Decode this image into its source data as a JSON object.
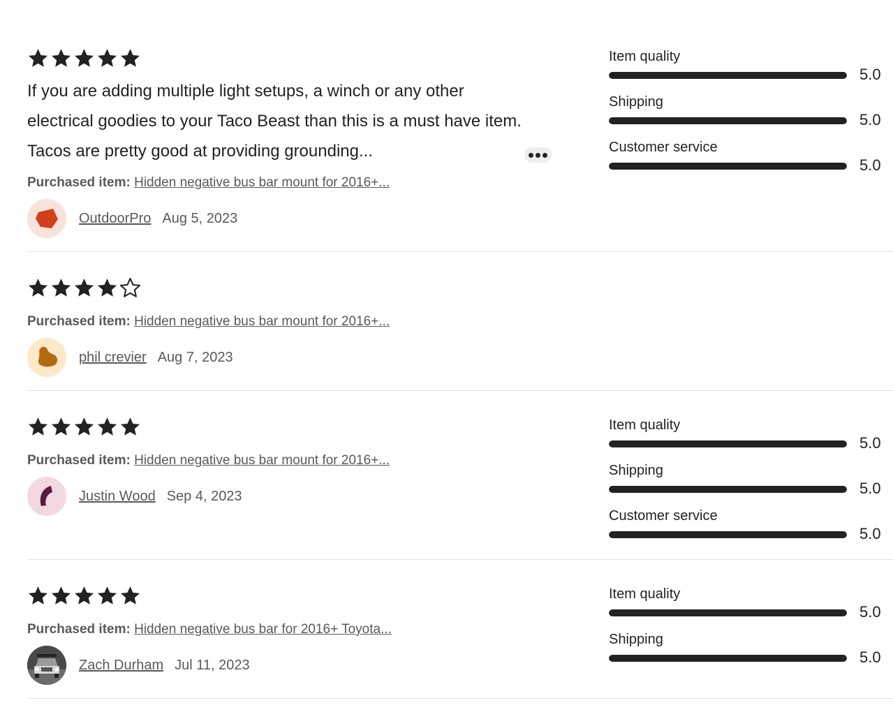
{
  "colors": {
    "bar": "#222222",
    "star": "#222222"
  },
  "reviews": [
    {
      "stars": 5,
      "text": "If you are adding multiple light setups, a winch or any other electrical goodies to your Taco Beast than this is a must have item. Tacos are pretty good at providing grounding...",
      "purchased_label": "Purchased item:",
      "purchased_item": "Hidden negative bus bar mount for 2016+...",
      "author": "OutdoorPro",
      "date": "Aug 5, 2023",
      "avatar_icon": "red-pentagon-avatar-icon",
      "ratings": [
        {
          "label": "Item quality",
          "value": "5.0",
          "fraction": 1.0
        },
        {
          "label": "Shipping",
          "value": "5.0",
          "fraction": 1.0
        },
        {
          "label": "Customer service",
          "value": "5.0",
          "fraction": 1.0
        }
      ]
    },
    {
      "stars": 4,
      "purchased_label": "Purchased item:",
      "purchased_item": "Hidden negative bus bar mount for 2016+...",
      "author": "phil crevier",
      "date": "Aug 7, 2023",
      "avatar_icon": "brown-blob-avatar-icon",
      "ratings": []
    },
    {
      "stars": 5,
      "purchased_label": "Purchased item:",
      "purchased_item": "Hidden negative bus bar mount for 2016+...",
      "author": "Justin Wood",
      "date": "Sep 4, 2023",
      "avatar_icon": "purple-crescent-avatar-icon",
      "ratings": [
        {
          "label": "Item quality",
          "value": "5.0",
          "fraction": 1.0
        },
        {
          "label": "Shipping",
          "value": "5.0",
          "fraction": 1.0
        },
        {
          "label": "Customer service",
          "value": "5.0",
          "fraction": 1.0
        }
      ]
    },
    {
      "stars": 5,
      "purchased_label": "Purchased item:",
      "purchased_item": "Hidden negative bus bar for 2016+ Toyota...",
      "author": "Zach Durham",
      "date": "Jul 11, 2023",
      "avatar_icon": "truck-photo-avatar-icon",
      "ratings": [
        {
          "label": "Item quality",
          "value": "5.0",
          "fraction": 1.0
        },
        {
          "label": "Shipping",
          "value": "5.0",
          "fraction": 1.0
        }
      ]
    }
  ]
}
